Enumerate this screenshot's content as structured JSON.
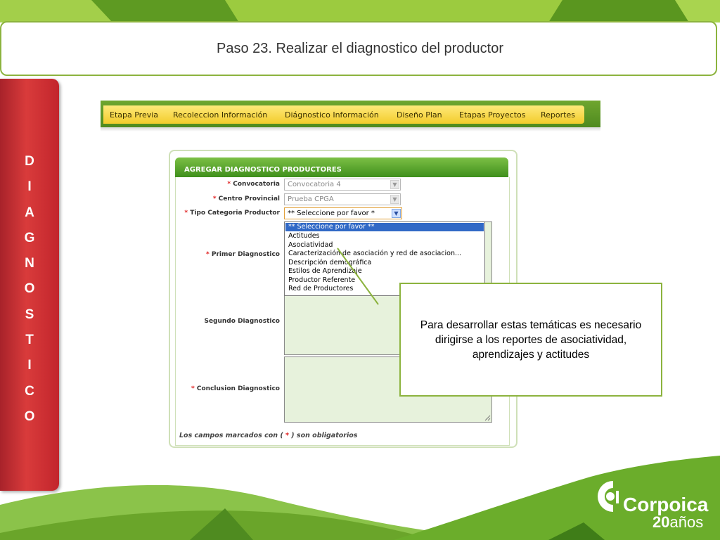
{
  "slide": {
    "title": "Paso 23. Realizar el diagnostico del productor",
    "side_letters": [
      "D",
      "I",
      "A",
      "G",
      "N",
      "O",
      "S",
      "T",
      "I",
      "C",
      "O"
    ],
    "colors": {
      "accent_green": "#8cb33e",
      "side_red": "#c62a30",
      "dark_green": "#3f8f1c"
    }
  },
  "app": {
    "menu": [
      "Etapa Previa",
      "Recoleccion Información",
      "Diágnostico Información",
      "Diseño Plan",
      "Etapas Proyectos",
      "Reportes"
    ],
    "form": {
      "header": "AGREGAR DIAGNOSTICO PRODUCTORES",
      "convocatoria_label": "Convocatoria",
      "convocatoria_value": "Convocatoria 4",
      "centro_label": "Centro Provincial",
      "centro_value": "Prueba CPGA",
      "tipo_label": "Tipo Categoria Productor",
      "tipo_value": "** Seleccione por favor *",
      "primer_label": "Primer Diagnostico",
      "segundo_label": "Segundo Diagnostico",
      "conclusion_label": "Conclusion Diagnostico",
      "required_mark": "*",
      "note_prefix": "Los campos marcados con (",
      "note_suffix": ") son obligatorios"
    },
    "dropdown_options": [
      "** Seleccione por favor **",
      "Actitudes",
      "Asociatividad",
      "Caracterización de asociación y red de asociacion...",
      "Descripción demográfica",
      "Estilos de Aprendizaje",
      "Productor Referente",
      "Red de Productores"
    ]
  },
  "callout": {
    "text": "Para desarrollar estas temáticas es necesario dirigirse a los reportes  de asociatividad, aprendizajes y actitudes"
  },
  "logo": {
    "name": "Corpoica",
    "years_number": "20",
    "years_word": "años",
    "icon": "corpoica-logo-icon"
  }
}
